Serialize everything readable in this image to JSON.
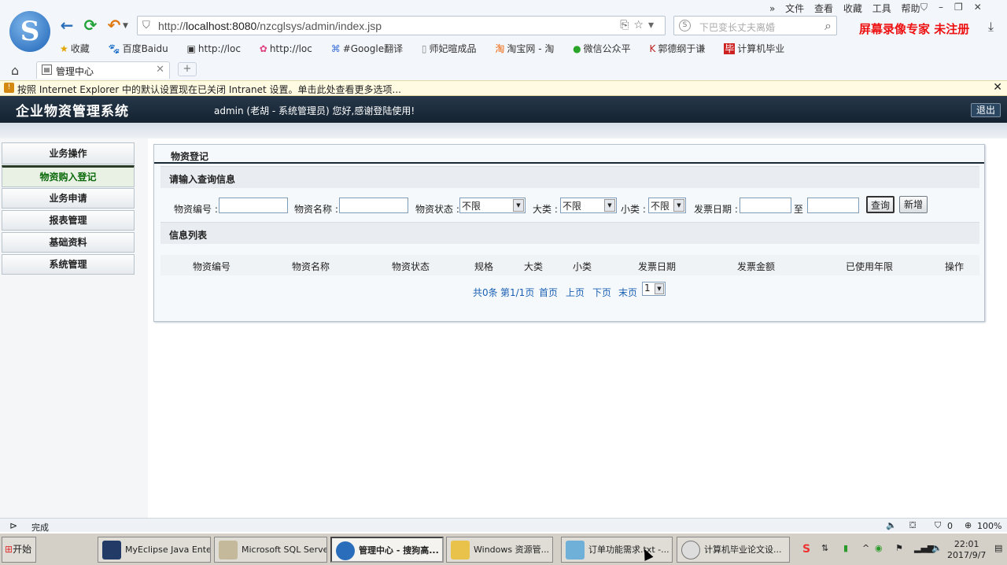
{
  "browser": {
    "url_prefix": "http://",
    "url_host": "localhost:8080",
    "url_path": "/nzcglsys/admin/index.jsp",
    "search_placeholder": "下巴变长丈夫离婚",
    "menu": [
      "文件",
      "查看",
      "收藏",
      "工具",
      "帮助"
    ],
    "watermark": "屏幕录像专家 未注册",
    "favorites": [
      "收藏",
      "百度Baidu",
      "http://loc",
      "http://loc",
      "#Google翻译",
      "师妃暄成品",
      "淘宝网 - 淘",
      "微信公众平",
      "郭德纲于谦",
      "计算机毕业"
    ],
    "tab_label": "管理中心",
    "newtab_label": "+",
    "info_text": "按照 Internet Explorer 中的默认设置现在已关闭 Intranet 设置。单击此处查看更多选项...",
    "status": "完成",
    "zoom": "100%",
    "status_count": "0"
  },
  "app": {
    "title": "企业物资管理系统",
    "user_info": "admin (老胡  - 系统管理员)   您好,感谢登陆使用!",
    "logout": "退出"
  },
  "sidebar": {
    "header": "业务操作",
    "active": "物资购入登记",
    "items": [
      "业务申请",
      "报表管理",
      "基础资料",
      "系统管理"
    ]
  },
  "main": {
    "panel_title": "物资登记",
    "query_section": "请输入查询信息",
    "list_section": "信息列表",
    "fields": {
      "code": "物资编号",
      "name": "物资名称",
      "status": "物资状态",
      "category": "大类",
      "subcategory": "小类",
      "invoice_date": "发票日期",
      "to": "至",
      "colon": ":"
    },
    "select_values": {
      "status": "不限",
      "category": "不限",
      "subcategory": "不限"
    },
    "buttons": {
      "query": "查询",
      "add": "新增"
    },
    "columns": [
      "物资编号",
      "物资名称",
      "物资状态",
      "规格",
      "大类",
      "小类",
      "发票日期",
      "发票金额",
      "已使用年限",
      "操作"
    ],
    "pager": {
      "total": "共0条",
      "page": "第1/1页",
      "first": "首页",
      "prev": "上页",
      "next": "下页",
      "last": "末页",
      "current": "1"
    }
  },
  "taskbar": {
    "start": "开始",
    "tasks": [
      "MyEclipse Java Ente...",
      "Microsoft SQL Serve...",
      "管理中心 - 搜狗高...",
      "Windows 资源管...",
      "订单功能需求.txt -...",
      "计算机毕业论文设..."
    ],
    "time": "22:01",
    "date": "2017/9/7"
  },
  "colors": {
    "header_bg": "#1c2c3c",
    "link": "#1a5fb4",
    "active_nav": "#0a6a0a",
    "watermark": "#e11111"
  }
}
